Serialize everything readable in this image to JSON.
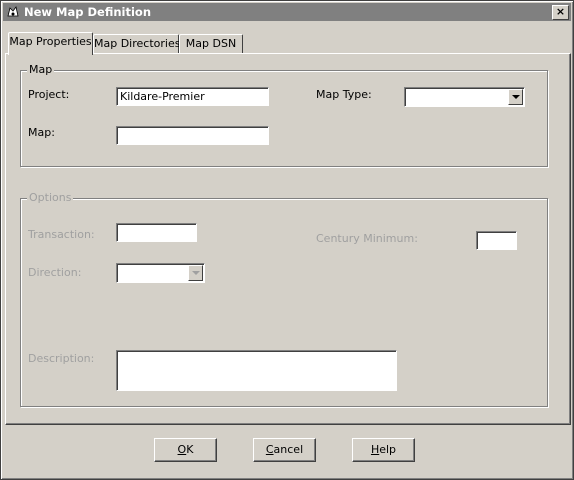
{
  "window": {
    "title": "New Map Definition",
    "close_label": "×"
  },
  "tabs": [
    {
      "label": "Map Properties",
      "active": true
    },
    {
      "label": "Map Directories",
      "active": false
    },
    {
      "label": "Map DSN",
      "active": false
    }
  ],
  "map_group": {
    "legend": "Map",
    "project_label": "Project:",
    "project_value": "Kildare-Premier",
    "map_label": "Map:",
    "map_value": "",
    "map_type_label": "Map Type:",
    "map_type_value": ""
  },
  "options_group": {
    "legend": "Options",
    "transaction_label": "Transaction:",
    "transaction_value": "",
    "direction_label": "Direction:",
    "direction_value": "",
    "century_minimum_label": "Century Minimum:",
    "century_minimum_value": "",
    "description_label": "Description:",
    "description_value": ""
  },
  "buttons": {
    "ok_mnemonic": "O",
    "ok_rest": "K",
    "cancel_mnemonic": "C",
    "cancel_rest": "ancel",
    "help_mnemonic": "H",
    "help_rest": "elp"
  }
}
